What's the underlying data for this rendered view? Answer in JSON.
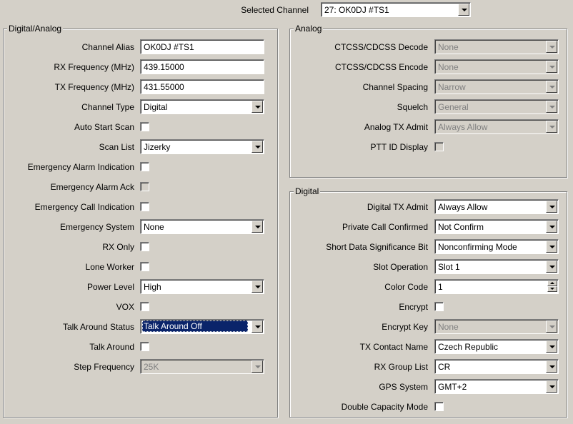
{
  "header": {
    "selected_channel_label": "Selected Channel",
    "selected_channel_value": "27: OK0DJ #TS1"
  },
  "digital_analog": {
    "title": "Digital/Analog",
    "channel_alias": {
      "label": "Channel Alias",
      "value": "OK0DJ #TS1"
    },
    "rx_frequency": {
      "label": "RX Frequency (MHz)",
      "value": "439.15000"
    },
    "tx_frequency": {
      "label": "TX Frequency (MHz)",
      "value": "431.55000"
    },
    "channel_type": {
      "label": "Channel Type",
      "value": "Digital"
    },
    "auto_start_scan": {
      "label": "Auto Start Scan"
    },
    "scan_list": {
      "label": "Scan List",
      "value": "Jizerky"
    },
    "emergency_alarm_indication": {
      "label": "Emergency Alarm Indication"
    },
    "emergency_alarm_ack": {
      "label": "Emergency Alarm Ack"
    },
    "emergency_call_indication": {
      "label": "Emergency Call Indication"
    },
    "emergency_system": {
      "label": "Emergency System",
      "value": "None"
    },
    "rx_only": {
      "label": "RX Only"
    },
    "lone_worker": {
      "label": "Lone Worker"
    },
    "power_level": {
      "label": "Power Level",
      "value": "High"
    },
    "vox": {
      "label": "VOX"
    },
    "talk_around_status": {
      "label": "Talk Around Status",
      "value": "Talk Around Off"
    },
    "talk_around": {
      "label": "Talk Around"
    },
    "step_frequency": {
      "label": "Step Frequency",
      "value": "25K"
    }
  },
  "analog": {
    "title": "Analog",
    "ctcss_decode": {
      "label": "CTCSS/CDCSS Decode",
      "value": "None"
    },
    "ctcss_encode": {
      "label": "CTCSS/CDCSS Encode",
      "value": "None"
    },
    "channel_spacing": {
      "label": "Channel Spacing",
      "value": "Narrow"
    },
    "squelch": {
      "label": "Squelch",
      "value": "General"
    },
    "analog_tx_admit": {
      "label": "Analog TX Admit",
      "value": "Always Allow"
    },
    "ptt_id_display": {
      "label": "PTT ID Display"
    }
  },
  "digital": {
    "title": "Digital",
    "digital_tx_admit": {
      "label": "Digital TX Admit",
      "value": "Always Allow"
    },
    "private_call_confirmed": {
      "label": "Private Call Confirmed",
      "value": "Not Confirm"
    },
    "short_data_significance_bit": {
      "label": "Short Data Significance Bit",
      "value": "Nonconfirming Mode"
    },
    "slot_operation": {
      "label": "Slot Operation",
      "value": "Slot 1"
    },
    "color_code": {
      "label": "Color Code",
      "value": "1"
    },
    "encrypt": {
      "label": "Encrypt"
    },
    "encrypt_key": {
      "label": "Encrypt Key",
      "value": "None"
    },
    "tx_contact_name": {
      "label": "TX Contact Name",
      "value": "Czech Republic"
    },
    "rx_group_list": {
      "label": "RX Group List",
      "value": "CR"
    },
    "gps_system": {
      "label": "GPS System",
      "value": "GMT+2"
    },
    "double_capacity_mode": {
      "label": "Double Capacity Mode"
    }
  },
  "colors": {
    "background": "#d4d0c8",
    "selection": "#0a246a",
    "disabled_text": "#808080"
  }
}
